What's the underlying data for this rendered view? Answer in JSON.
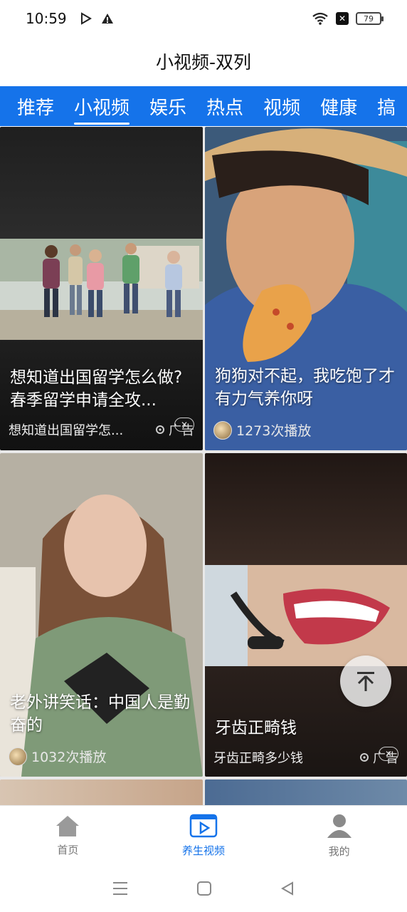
{
  "status_bar": {
    "time": "10:59",
    "battery": "79"
  },
  "header": {
    "title": "小视频-双列"
  },
  "tabs": [
    {
      "label": "推荐"
    },
    {
      "label": "小视频"
    },
    {
      "label": "娱乐"
    },
    {
      "label": "热点"
    },
    {
      "label": "视频"
    },
    {
      "label": "健康"
    },
    {
      "label": "搞"
    }
  ],
  "cards": [
    {
      "title": "想知道出国留学怎么做?春季留学申请全攻...",
      "subtitle": "想知道出国留学怎...",
      "ad_label": "广告"
    },
    {
      "title": "狗狗对不起，我吃饱了才有力气养你呀",
      "plays": "1273次播放"
    },
    {
      "title": "老外讲笑话：中国人是勤奋的",
      "plays": "1032次播放"
    },
    {
      "title": "牙齿正畸钱",
      "subtitle": "牙齿正畸多少钱",
      "ad_label": "广告"
    }
  ],
  "bottom_nav": [
    {
      "label": "首页",
      "icon": "home-icon"
    },
    {
      "label": "养生视频",
      "icon": "video-play-icon"
    },
    {
      "label": "我的",
      "icon": "person-icon"
    }
  ],
  "colors": {
    "accent": "#1573ea",
    "tab_bar": "#1573ea"
  }
}
